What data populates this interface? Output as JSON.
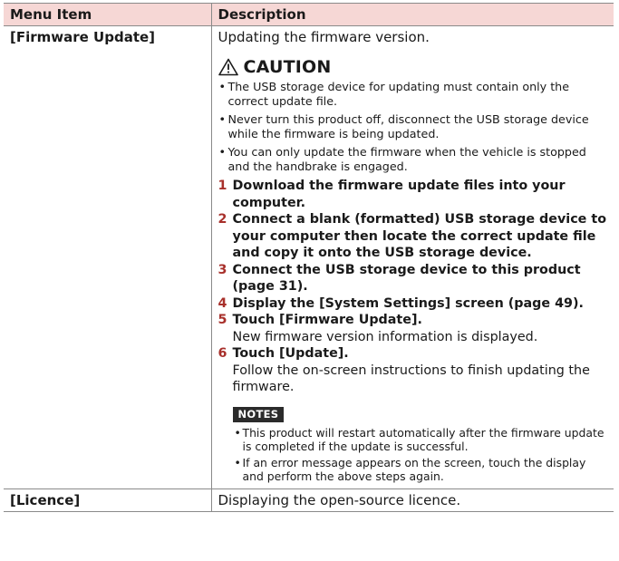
{
  "table": {
    "header": {
      "col1": "Menu Item",
      "col2": "Description"
    },
    "rows": [
      {
        "item": "[Firmware Update]",
        "intro": "Updating the firmware version.",
        "caution_title": "CAUTION",
        "caution_icon": "warning-triangle-icon",
        "bullet": "•",
        "cautions": [
          "The USB storage device for updating must contain only the correct update file.",
          "Never turn this product off, disconnect the USB storage device while the firmware is being updated.",
          "You can only update the firmware when the vehicle is stopped and the handbrake is engaged."
        ],
        "steps": [
          {
            "n": "1",
            "text": "Download the firmware update files into your computer.",
            "sub": ""
          },
          {
            "n": "2",
            "text": "Connect a blank (formatted) USB storage device to your computer then locate the correct update file and copy it onto the USB storage device.",
            "sub": ""
          },
          {
            "n": "3",
            "text": "Connect the USB storage device to this product (page 31).",
            "sub": ""
          },
          {
            "n": "4",
            "text": "Display the [System Settings] screen (page 49).",
            "sub": ""
          },
          {
            "n": "5",
            "text": "Touch [Firmware Update].",
            "sub": "New firmware version information is displayed."
          },
          {
            "n": "6",
            "text": "Touch [Update].",
            "sub": "Follow the on-screen instructions to finish updating the firmware."
          }
        ],
        "notes_label": "NOTES",
        "notes": [
          "This product will restart automatically after the firmware update is completed if the update is successful.",
          "If an error message appears on the screen, touch the display and perform the above steps again."
        ]
      },
      {
        "item": "[Licence]",
        "intro": "Displaying the open-source licence."
      }
    ]
  },
  "colors": {
    "header_bg": "#f6d7d5",
    "step_number": "#a8302b",
    "notes_badge_bg": "#2b2b2b",
    "rule": "#8a8a8a"
  }
}
